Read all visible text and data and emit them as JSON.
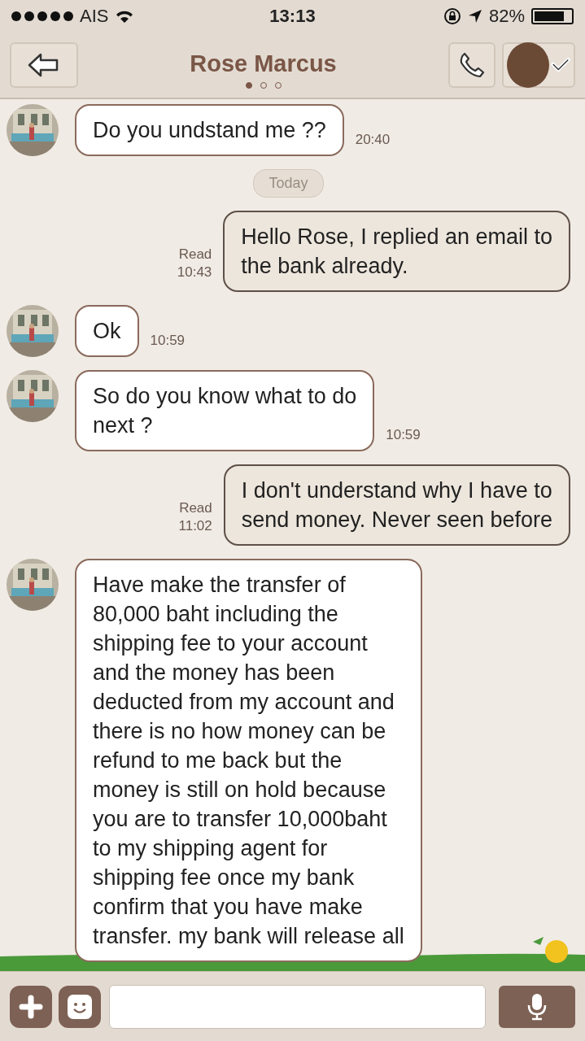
{
  "status_bar": {
    "carrier": "AIS",
    "time": "13:13",
    "battery": "82%"
  },
  "header": {
    "title": "Rose Marcus",
    "pages": [
      {
        "selected": true
      },
      {
        "selected": false
      },
      {
        "selected": false
      }
    ]
  },
  "messages": [
    {
      "kind": "incoming",
      "text": "Do you undstand me ??",
      "time": "20:40"
    },
    {
      "kind": "date",
      "text": "Today"
    },
    {
      "kind": "outgoing",
      "text": "Hello Rose, I replied an email to\nthe bank already.",
      "status": "Read",
      "time": "10:43"
    },
    {
      "kind": "incoming",
      "text": "Ok",
      "time": "10:59"
    },
    {
      "kind": "incoming",
      "text": "So do you know what to do\nnext ?",
      "time": "10:59"
    },
    {
      "kind": "outgoing",
      "text": "I don't understand why I have to\nsend money. Never seen before",
      "status": "Read",
      "time": "11:02"
    },
    {
      "kind": "incoming",
      "text": "Have make the transfer of\n80,000 baht including the\nshipping fee to your account\nand the money has been\ndeducted from my account and\nthere is no how money can be\nrefund to me back  but the\nmoney is still on hold because\nyou are to transfer 10,000baht\nto my shipping agent for\nshipping fee once my bank\nconfirm that you have make\ntransfer. my bank will release all"
    }
  ]
}
